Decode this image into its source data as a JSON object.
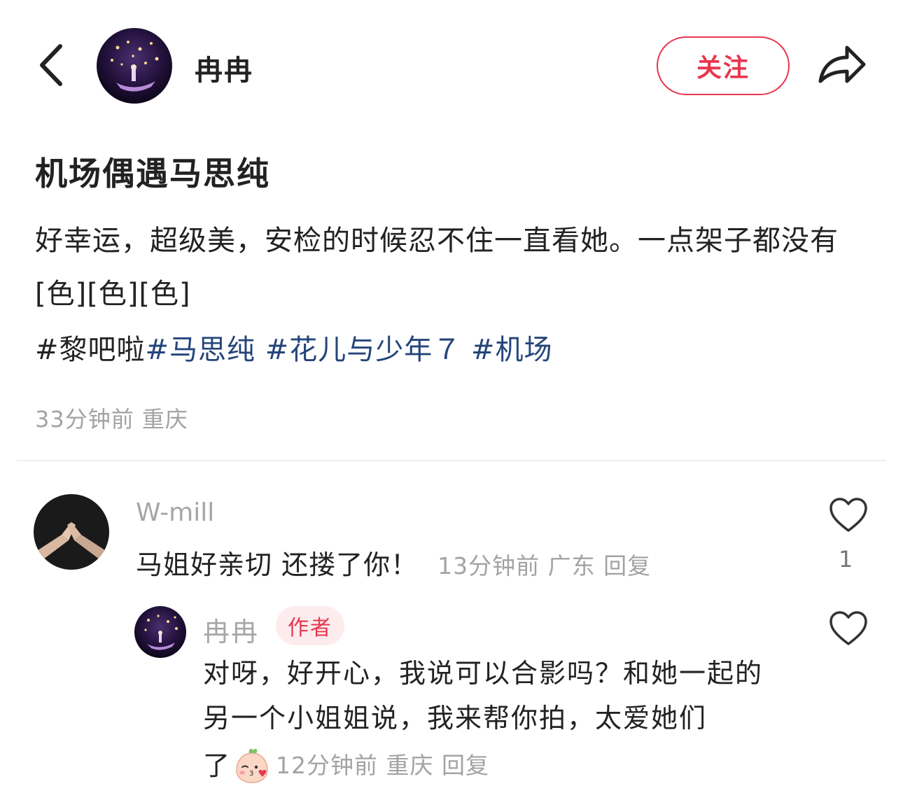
{
  "header": {
    "author_name": "冉冉",
    "follow_label": "关注"
  },
  "post": {
    "title": "机场偶遇马思纯",
    "body": "好幸运，超级美，安检的时候忍不住一直看她。一点架子都没有[色][色][色]",
    "tag_plain": "#黎吧啦",
    "tags": [
      "#马思纯",
      "#花儿与少年７",
      "#机场"
    ],
    "time": "33分钟前",
    "location": "重庆"
  },
  "comment": {
    "user": "W-mill",
    "text": "马姐好亲切 还搂了你！",
    "time": "13分钟前",
    "location": "广东",
    "reply_label": "回复",
    "likes": "1"
  },
  "reply": {
    "user": "冉冉",
    "badge": "作者",
    "text": "对呀，好开心，我说可以合影吗？和她一起的另一个小姐姐说，我来帮你拍，太爱她们",
    "text_end": "了",
    "time": "12分钟前",
    "location": "重庆",
    "reply_label": "回复"
  },
  "colors": {
    "accent": "#e8364f",
    "tag": "#24457a",
    "muted": "#a3a3a3"
  },
  "icons": [
    "back-arrow-icon",
    "share-arrow-icon",
    "heart-outline-icon",
    "blush-emoji-icon"
  ]
}
